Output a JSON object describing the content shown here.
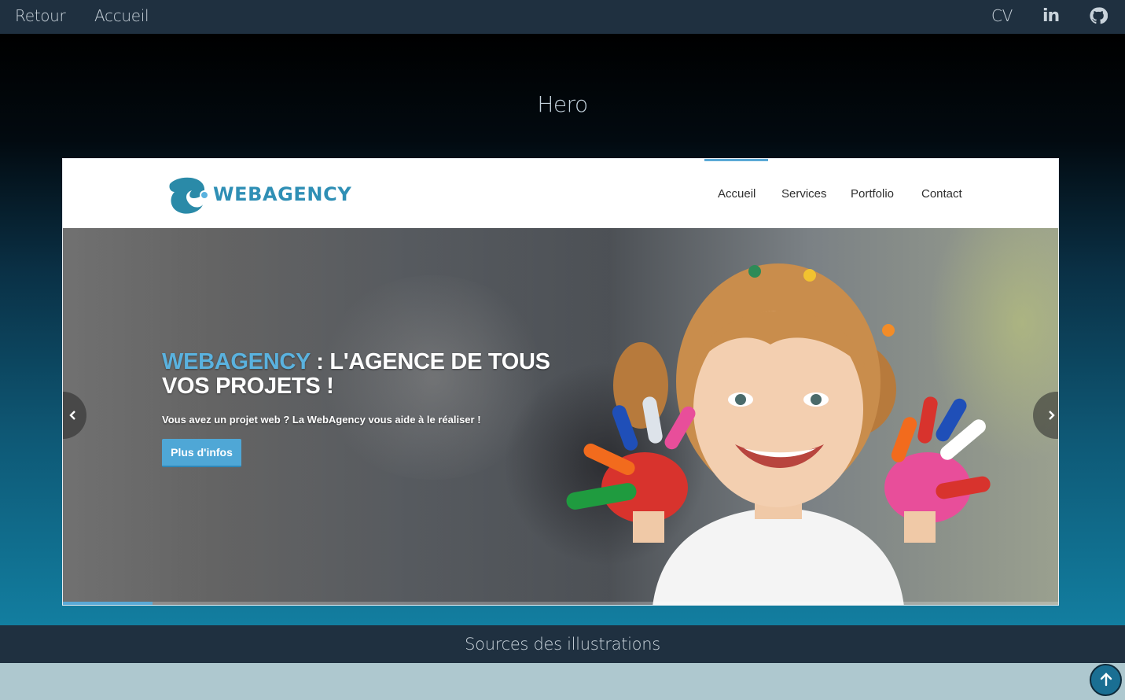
{
  "topbar": {
    "back_label": "Retour",
    "home_label": "Accueil",
    "cv_label": "CV",
    "linkedin_icon": "linkedin-icon",
    "linkedin_glyph": "in",
    "github_icon": "github-icon"
  },
  "hero": {
    "title": "Hero"
  },
  "preview": {
    "logo_text": "WEBAGENCY",
    "nav": [
      "Accueil",
      "Services",
      "Portfolio",
      "Contact"
    ],
    "active_nav": "Accueil",
    "slide": {
      "title_brand": "WEBAGENCY",
      "title_rest": " : L'AGENCE DE TOUS VOS PROJETS !",
      "subtitle": "Vous avez un projet web ? La WebAgency vous aide à le réaliser !",
      "button_label": "Plus d'infos",
      "progress_percent": 9
    }
  },
  "footer": {
    "sources_label": "Sources des illustrations"
  },
  "colors": {
    "topbar": "#1f3040",
    "accent": "#5aa9d6",
    "brand": "#2f8fb5",
    "bottom": "#aec8cf"
  }
}
